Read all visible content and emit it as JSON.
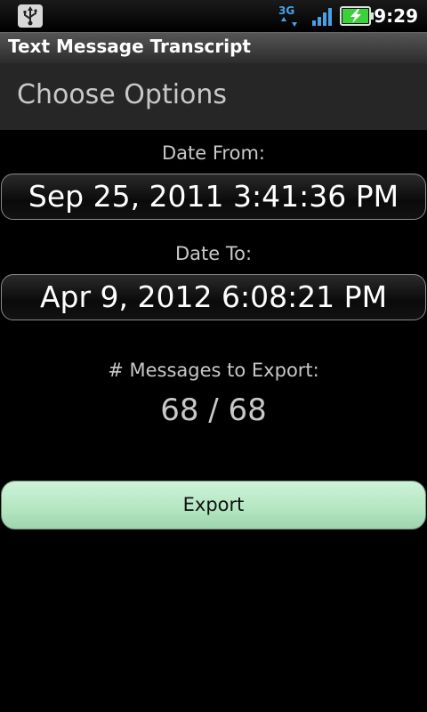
{
  "status_bar": {
    "time": "9:29",
    "network": "3G",
    "icons": [
      "usb-icon",
      "3g-data-icon",
      "signal-strength-icon",
      "battery-charging-icon"
    ]
  },
  "app": {
    "title": "Text Message Transcript"
  },
  "header": {
    "title": "Choose Options"
  },
  "form": {
    "date_from_label": "Date From:",
    "date_from_value": "Sep 25, 2011 3:41:36 PM",
    "date_to_label": "Date To:",
    "date_to_value": "Apr 9, 2012 6:08:21 PM",
    "count_label": "# Messages to Export:",
    "count_value": "68 / 68",
    "export_label": "Export"
  },
  "colors": {
    "background": "#000000",
    "export_button": "#b5e7c3",
    "battery_green": "#3ad13a",
    "network_blue": "#4aa0e8"
  }
}
